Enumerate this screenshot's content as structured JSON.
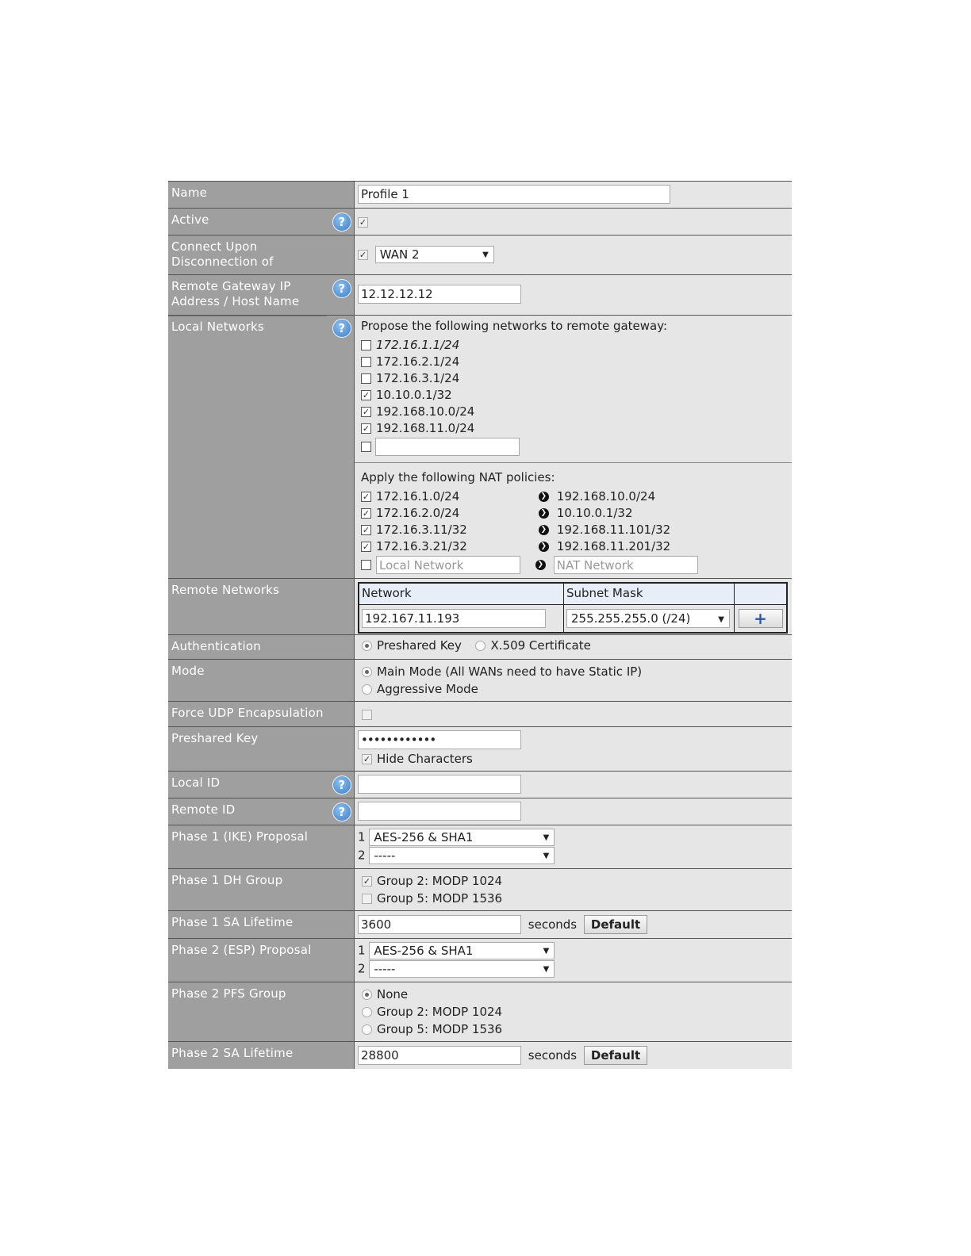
{
  "name": {
    "label": "Name",
    "value": "Profile 1"
  },
  "active": {
    "label": "Active",
    "checked": true
  },
  "connect": {
    "label": "Connect Upon Disconnection of",
    "label_line1": "Connect Upon",
    "label_line2": "Disconnection of",
    "checked": true,
    "wan": "WAN 2"
  },
  "remote_gateway": {
    "label_line1": "Remote Gateway IP",
    "label_line2": "Address / Host Name",
    "value": "12.12.12.12"
  },
  "local_networks": {
    "label": "Local Networks",
    "propose_heading": "Propose the following networks to remote gateway:",
    "networks": [
      {
        "value": "172.16.1.1/24",
        "checked": false
      },
      {
        "value": "172.16.2.1/24",
        "checked": false
      },
      {
        "value": "172.16.3.1/24",
        "checked": false
      },
      {
        "value": "10.10.0.1/32",
        "checked": true
      },
      {
        "value": "192.168.10.0/24",
        "checked": true
      },
      {
        "value": "192.168.11.0/24",
        "checked": true
      }
    ],
    "nat_heading": "Apply the following NAT policies:",
    "nat": [
      {
        "local": "172.16.1.0/24",
        "nat": "192.168.10.0/24",
        "checked": true
      },
      {
        "local": "172.16.2.0/24",
        "nat": "10.10.0.1/32",
        "checked": true
      },
      {
        "local": "172.16.3.11/32",
        "nat": "192.168.11.101/32",
        "checked": true
      },
      {
        "local": "172.16.3.21/32",
        "nat": "192.168.11.201/32",
        "checked": true
      }
    ],
    "local_placeholder": "Local Network",
    "nat_placeholder": "NAT Network"
  },
  "remote_networks": {
    "label": "Remote Networks",
    "col_network": "Network",
    "col_mask": "Subnet Mask",
    "network_value": "192.167.11.193",
    "mask_value": "255.255.255.0 (/24)",
    "add_symbol": "+"
  },
  "authentication": {
    "label": "Authentication",
    "opt1": "Preshared Key",
    "opt2": "X.509 Certificate",
    "selected": "Preshared Key"
  },
  "mode": {
    "label": "Mode",
    "opt1": "Main Mode (All WANs need to have Static IP)",
    "opt2": "Aggressive Mode",
    "selected": "Main Mode"
  },
  "force_udp": {
    "label": "Force UDP Encapsulation",
    "checked": false
  },
  "preshared_key": {
    "label": "Preshared Key",
    "value": "••••••••••••",
    "hide_label": "Hide Characters",
    "hide_checked": true
  },
  "local_id": {
    "label": "Local ID",
    "value": ""
  },
  "remote_id": {
    "label": "Remote ID",
    "value": ""
  },
  "phase1_proposal": {
    "label": "Phase 1 (IKE) Proposal",
    "n1": "1",
    "v1": "AES-256 & SHA1",
    "n2": "2",
    "v2": "-----"
  },
  "phase1_dh": {
    "label": "Phase 1 DH Group",
    "opt1": "Group 2: MODP 1024",
    "opt1_checked": true,
    "opt2": "Group 5: MODP 1536",
    "opt2_checked": false
  },
  "phase1_sa": {
    "label": "Phase 1 SA Lifetime",
    "value": "3600",
    "unit": "seconds",
    "default_btn": "Default"
  },
  "phase2_proposal": {
    "label": "Phase 2 (ESP) Proposal",
    "n1": "1",
    "v1": "AES-256 & SHA1",
    "n2": "2",
    "v2": "-----"
  },
  "phase2_pfs": {
    "label": "Phase 2 PFS Group",
    "opt1": "None",
    "opt2": "Group 2: MODP 1024",
    "opt3": "Group 5: MODP 1536",
    "selected": "None"
  },
  "phase2_sa": {
    "label": "Phase 2 SA Lifetime",
    "value": "28800",
    "unit": "seconds",
    "default_btn": "Default"
  },
  "icons": {
    "help": "?",
    "check": "✓",
    "dropdown": "▼",
    "arrow": "❯"
  },
  "colors": {
    "label_bg": "#9f9f9f",
    "value_bg": "#e6e6e6",
    "help_blue": "#3b7dc8",
    "plus_blue": "#2c5aa0"
  }
}
